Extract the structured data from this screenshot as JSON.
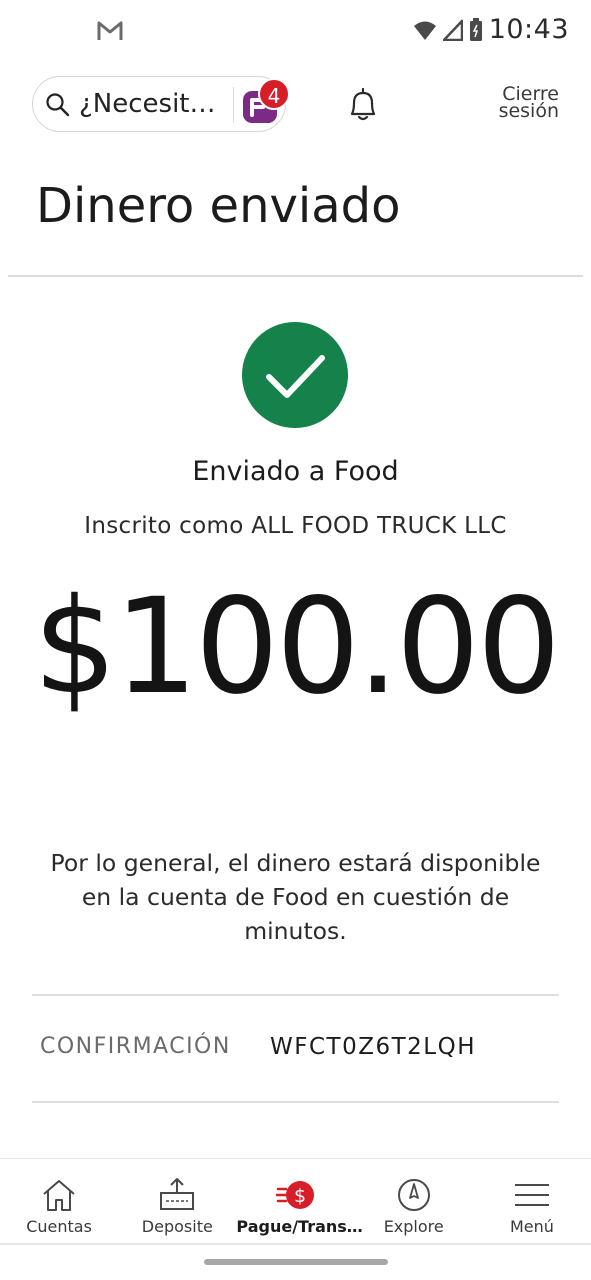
{
  "status_bar": {
    "time": "10:43",
    "left_icon": "gmail-icon",
    "right_icons": [
      "wifi-icon",
      "signal-icon",
      "battery-icon"
    ]
  },
  "header": {
    "search_placeholder": "¿Necesit…",
    "assistant_icon": "fargo-icon",
    "assistant_badge": "4",
    "notifications_icon": "bell-icon",
    "logout_label_line1": "Cierre",
    "logout_label_line2": "sesión"
  },
  "page": {
    "title": "Dinero enviado"
  },
  "confirmation": {
    "status_icon": "check-icon",
    "sent_to": "Enviado a Food",
    "enrolled_as": "Inscrito como ALL FOOD TRUCK LLC",
    "amount": "$100.00",
    "note": "Por lo general, el dinero estará disponible en la cuenta de Food en cuestión de minutos.",
    "confirmation_label": "CONFIRMACIÓN",
    "confirmation_number": "WFCT0Z6T2LQH"
  },
  "bottom_nav": {
    "items": [
      {
        "label": "Cuentas",
        "icon": "home-icon",
        "active": false
      },
      {
        "label": "Deposite",
        "icon": "deposit-icon",
        "active": false
      },
      {
        "label": "Pague/Trans…",
        "icon": "pay-transfer-icon",
        "active": true
      },
      {
        "label": "Explore",
        "icon": "compass-icon",
        "active": false
      },
      {
        "label": "Menú",
        "icon": "hamburger-menu-icon",
        "active": false
      }
    ]
  },
  "colors": {
    "success_green": "#14824a",
    "badge_red": "#d71e28",
    "fargo_purple": "#7b2b86"
  }
}
